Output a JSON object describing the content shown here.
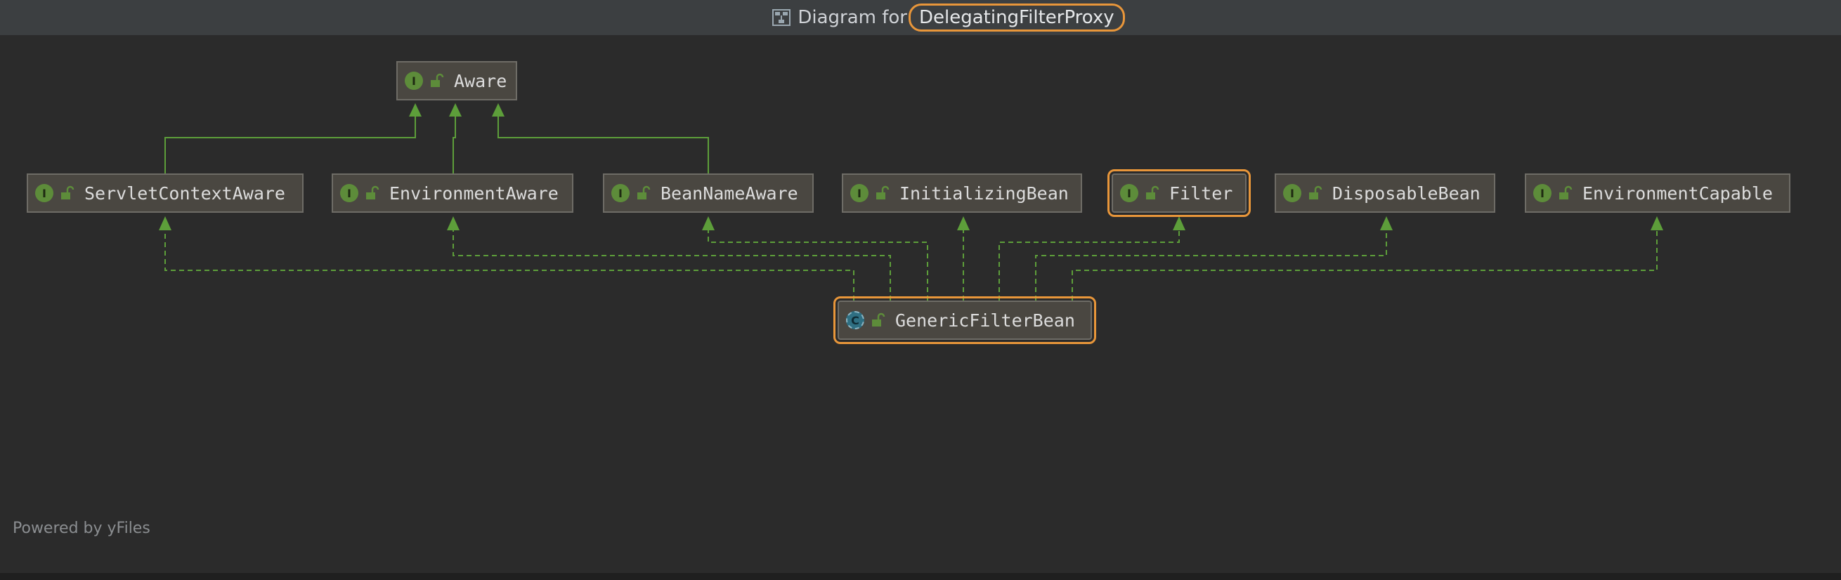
{
  "window": {
    "title_prefix": "Diagram for",
    "title_class": "DelegatingFilterProxy",
    "icon": "diagram-icon"
  },
  "nodes": {
    "aware": {
      "label": "Aware",
      "kind": "I"
    },
    "servlet_context_aware": {
      "label": "ServletContextAware",
      "kind": "I"
    },
    "environment_aware": {
      "label": "EnvironmentAware",
      "kind": "I"
    },
    "bean_name_aware": {
      "label": "BeanNameAware",
      "kind": "I"
    },
    "initializing_bean": {
      "label": "InitializingBean",
      "kind": "I"
    },
    "filter": {
      "label": "Filter",
      "kind": "I"
    },
    "disposable_bean": {
      "label": "DisposableBean",
      "kind": "I"
    },
    "environment_capable": {
      "label": "EnvironmentCapable",
      "kind": "I"
    },
    "generic_filter_bean": {
      "label": "GenericFilterBean",
      "kind": "C"
    }
  },
  "footer": {
    "powered_by": "Powered by yFiles"
  },
  "colors": {
    "background": "#2b2b2b",
    "node_fill": "#4a4741",
    "edge": "#5d9e3a",
    "highlight": "#e8963a",
    "interface_icon": "#5d8c3a",
    "class_icon": "#2f6f82"
  }
}
